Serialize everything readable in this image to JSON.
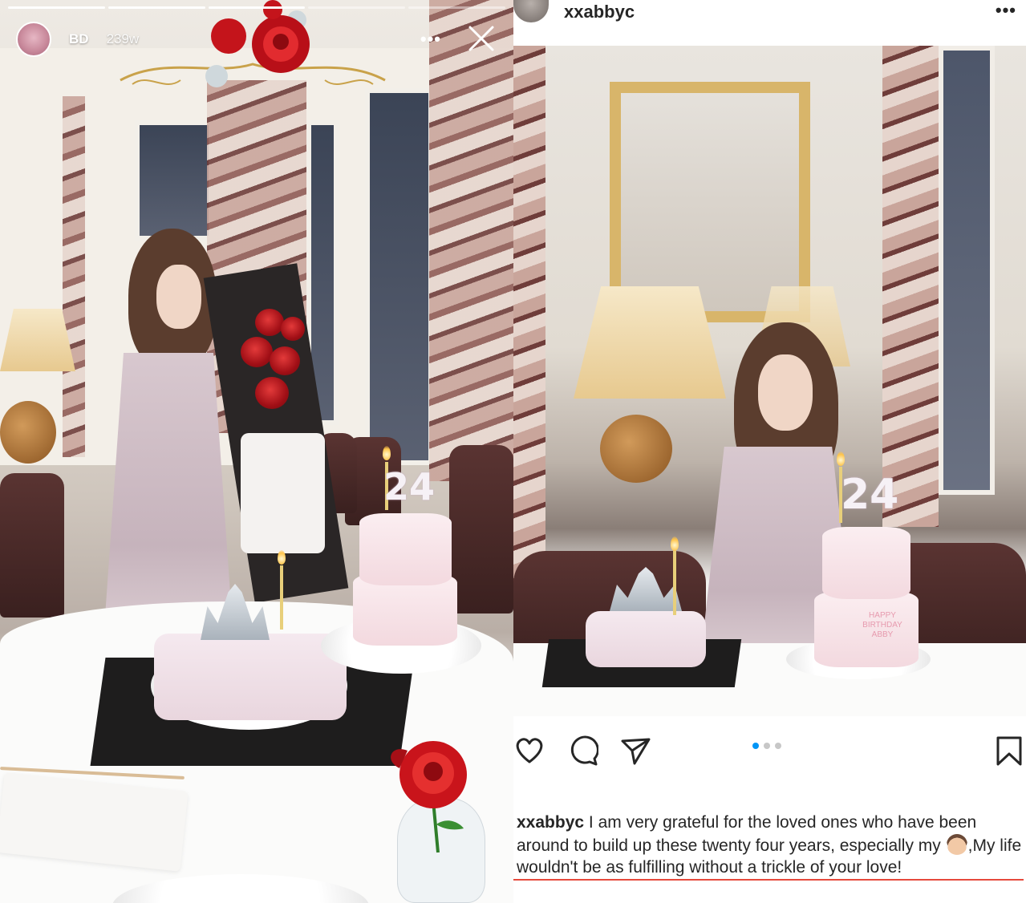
{
  "story": {
    "progress_segments": 5,
    "progress_done": 3,
    "username": "BD",
    "time_ago": "239w",
    "more_label": "•••",
    "close_icon": "close-icon"
  },
  "post": {
    "username": "xxabbyc",
    "more_label": "•••",
    "carousel": {
      "total": 3,
      "active_index": 0
    },
    "actions": [
      "heart-icon",
      "comment-icon",
      "send-icon",
      "bookmark-icon"
    ],
    "caption": {
      "username": "xxabbyc",
      "text_part1": " I am very grateful for the loved ones who have been around to build up these twenty four years, especially my ",
      "emoji": "boy-face-emoji",
      "text_part2": ",My life wouldn't be as fulfilling without a trickle of your love!"
    }
  },
  "cake_left": {
    "number": "24"
  },
  "cake_right": {
    "number": "24",
    "plaque": "HAPPY BIRTHDAY ABBY"
  },
  "colors": {
    "accent_blue": "#0095f6",
    "underline_red": "#e64a3c",
    "text": "#262626"
  }
}
